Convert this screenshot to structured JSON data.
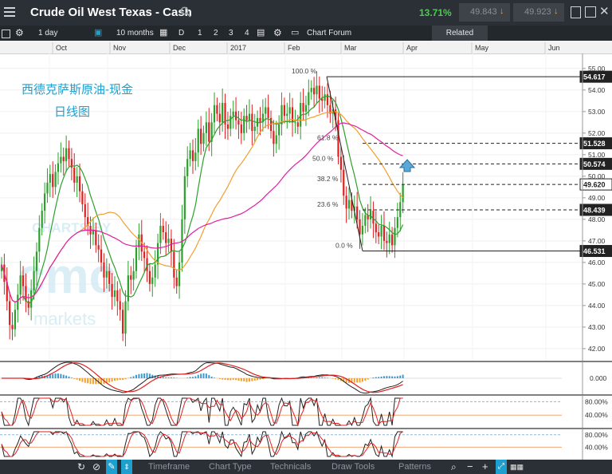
{
  "header": {
    "title": "Crude Oil West Texas - Cash",
    "change_pct": "13.71%",
    "bid": "49.843",
    "ask": "49.923"
  },
  "toolbar": {
    "interval": "1 day",
    "range": "10 months",
    "draw_tools": [
      "D",
      "1",
      "2",
      "3",
      "4"
    ],
    "chart_forum": "Chart Forum",
    "related": "Related"
  },
  "overlay": {
    "title": "西德克萨斯原油-现金",
    "subtitle": "日线图",
    "watermark_1": "CHARTS BY",
    "watermark_2": "cmc",
    "watermark_3": "markets"
  },
  "bottombar": {
    "timeframe": "Timeframe",
    "chart_type": "Chart Type",
    "technicals": "Technicals",
    "draw_tools": "Draw Tools",
    "patterns": "Patterns"
  },
  "chart_data": {
    "type": "candlestick",
    "x_months": [
      "Oct",
      "Nov",
      "Dec",
      "2017",
      "Feb",
      "Mar",
      "Apr",
      "May",
      "Jun"
    ],
    "ylim": [
      41.7,
      55.4
    ],
    "y_ticks": [
      42.0,
      43.0,
      44.0,
      45.0,
      46.0,
      47.0,
      48.0,
      49.0,
      50.0,
      51.0,
      52.0,
      53.0,
      54.0,
      55.0
    ],
    "last_price": "49.620",
    "close": [
      45.9,
      45.1,
      44.2,
      43.1,
      42.9,
      43.8,
      44.5,
      45.4,
      44.9,
      44.2,
      43.9,
      44.7,
      45.6,
      46.5,
      47.6,
      48.4,
      49.2,
      49.7,
      50.1,
      49.5,
      50.2,
      50.6,
      50.9,
      50.7,
      51.3,
      50.8,
      50.4,
      49.7,
      50.0,
      49.3,
      48.7,
      48.1,
      47.7,
      47.3,
      47.5,
      46.8,
      46.6,
      46.0,
      45.3,
      45.6,
      45.0,
      44.4,
      44.7,
      44.2,
      43.8,
      42.7,
      44.2,
      45.4,
      45.2,
      45.6,
      46.7,
      47.3,
      46.5,
      46.2,
      45.6,
      45.0,
      45.3,
      45.9,
      46.9,
      47.7,
      47.4,
      46.9,
      47.1,
      46.5,
      45.3,
      44.9,
      46.0,
      48.0,
      50.0,
      50.8,
      51.2,
      50.7,
      51.1,
      52.2,
      51.5,
      52.0,
      52.5,
      51.6,
      52.5,
      53.3,
      52.9,
      52.5,
      53.4,
      52.4,
      52.2,
      52.8,
      53.0,
      52.6,
      52.4,
      52.0,
      52.8,
      52.6,
      52.9,
      52.1,
      52.3,
      52.7,
      52.5,
      52.9,
      53.2,
      52.7,
      52.1,
      51.5,
      51.9,
      52.4,
      53.3,
      52.8,
      52.9,
      53.2,
      52.5,
      52.5,
      52.3,
      53.4,
      53.0,
      53.3,
      53.9,
      54.1,
      53.8,
      54.2,
      53.6,
      53.5,
      53.8,
      53.3,
      52.9,
      53.1,
      52.6,
      50.9,
      50.3,
      49.1,
      48.5,
      48.9,
      48.4,
      48.6,
      48.0,
      47.3,
      47.7,
      48.2,
      48.0,
      48.4,
      47.8,
      47.4,
      47.2,
      47.7,
      47.0,
      46.9,
      47.3,
      46.8,
      47.6,
      48.1,
      48.8,
      49.6
    ]
  },
  "fibonacci": {
    "levels": [
      {
        "label": "100.0 %",
        "price": "54.617"
      },
      {
        "label": "61.8 %",
        "price": "51.528"
      },
      {
        "label": "50.0 %",
        "price": "50.574"
      },
      {
        "label": "38.2 %",
        "price": "49.620"
      },
      {
        "label": "23.6 %",
        "price": "48.439"
      },
      {
        "label": "0.0 %",
        "price": "46.531"
      }
    ]
  },
  "indicators": {
    "macd_label": "0.000",
    "stoch1_labels": [
      "80.00%",
      "40.00%"
    ],
    "stoch2_labels": [
      "80.00%",
      "40.00%"
    ]
  },
  "colors": {
    "up": "#2ba02b",
    "down": "#e02020",
    "ma_fast": "#2ca02c",
    "ma_mid": "#f0a030",
    "ma_slow": "#e020a0",
    "change": "#45d04a",
    "accent": "#1da0d0"
  }
}
